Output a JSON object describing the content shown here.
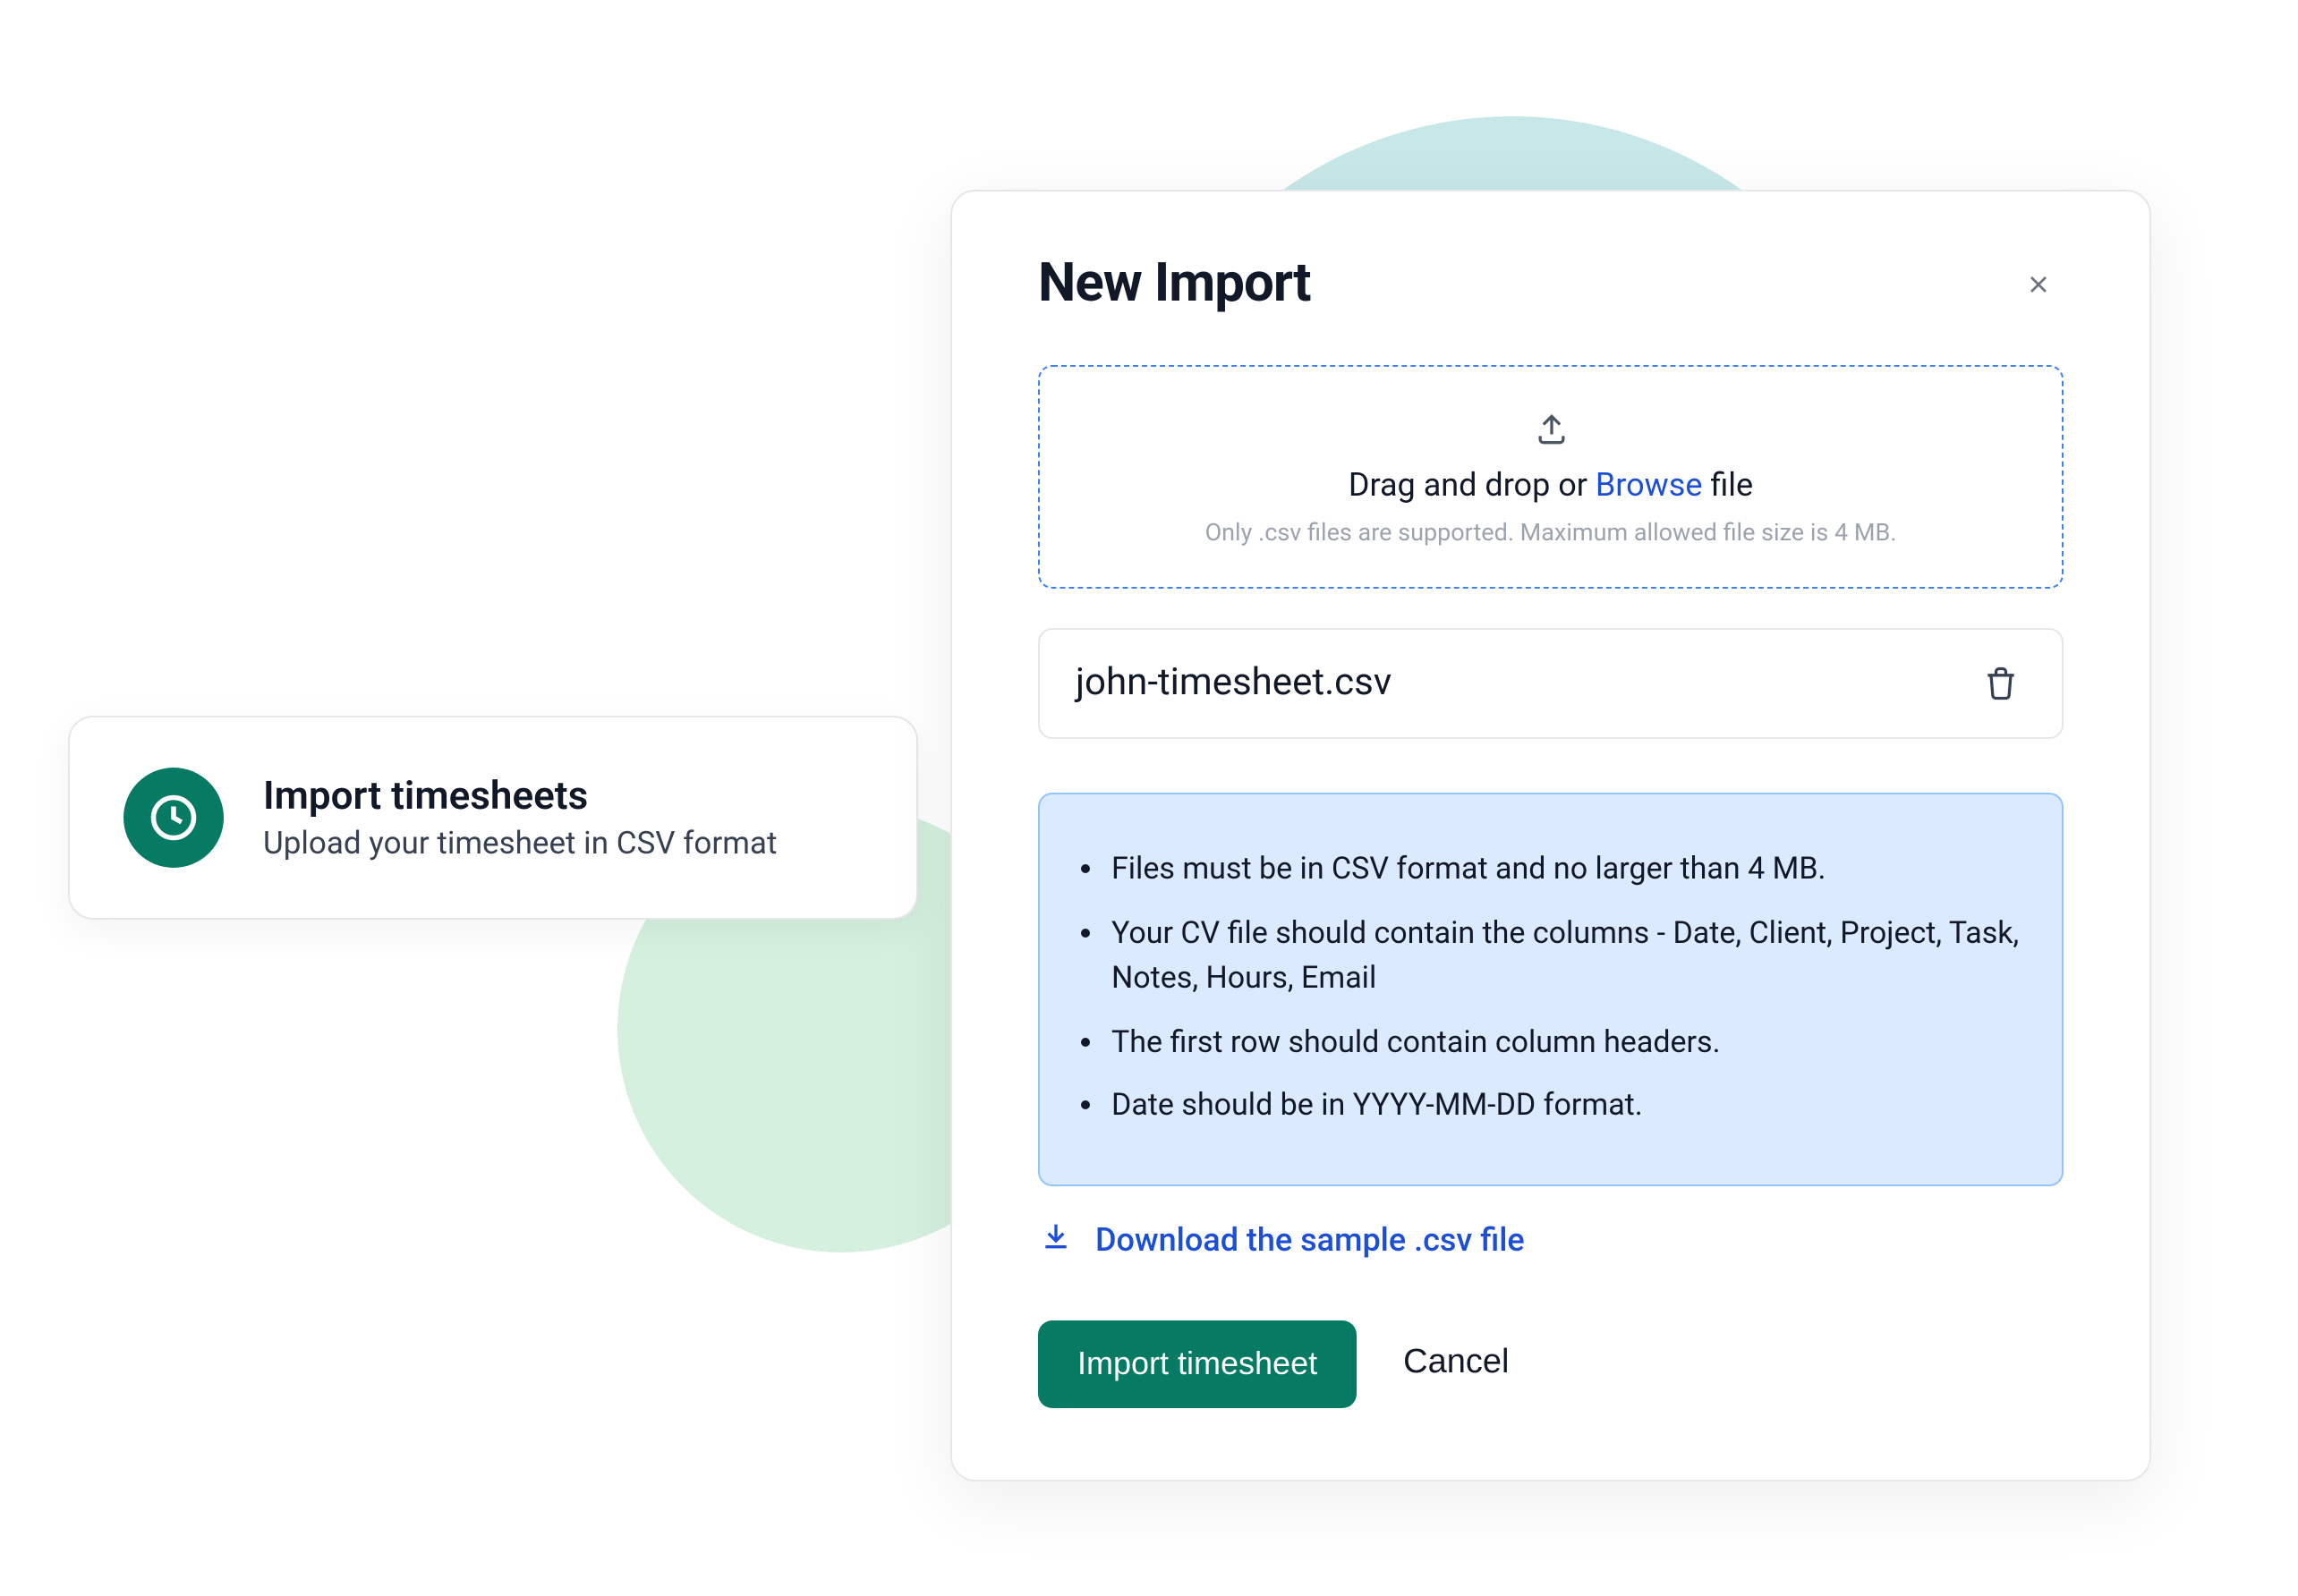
{
  "left_card": {
    "title": "Import timesheets",
    "subtitle": "Upload your timesheet in CSV format"
  },
  "modal": {
    "title": "New Import",
    "dropzone": {
      "prefix": "Drag and drop or ",
      "browse": "Browse",
      "suffix": " file",
      "hint": "Only .csv files are supported. Maximum allowed file size is 4 MB."
    },
    "file": {
      "name": "john-timesheet.csv"
    },
    "info_items": [
      "Files must be in CSV format and no larger than 4 MB.",
      "Your CV file should contain the columns - Date, Client, Project, Task, Notes, Hours, Email",
      "The first row should contain column headers.",
      "Date should be in YYYY-MM-DD format."
    ],
    "download_label": "Download the sample .csv file",
    "buttons": {
      "primary": "Import timesheet",
      "cancel": "Cancel"
    }
  }
}
